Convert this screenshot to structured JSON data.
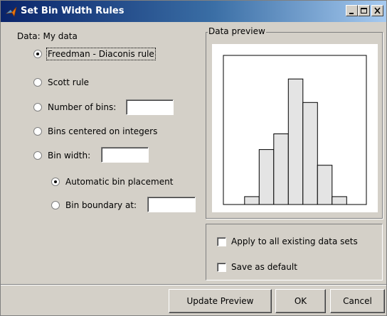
{
  "window": {
    "title": "Set Bin Width Rules"
  },
  "data_label": "Data: My data",
  "rules": [
    {
      "label": "Freedman - Diaconis rule",
      "selected": true
    },
    {
      "label": "Scott rule",
      "selected": false
    },
    {
      "label": "Number of bins:",
      "selected": false,
      "value": ""
    },
    {
      "label": "Bins centered on integers",
      "selected": false
    },
    {
      "label": "Bin width:",
      "selected": false,
      "value": ""
    }
  ],
  "placement": [
    {
      "label": "Automatic bin placement",
      "selected": true
    },
    {
      "label": "Bin boundary at:",
      "selected": false,
      "value": ""
    }
  ],
  "preview": {
    "title": "Data preview",
    "chart_data": {
      "type": "bar",
      "title": "",
      "xlabel": "",
      "ylabel": "",
      "values": [
        1,
        7,
        9,
        16,
        13,
        5,
        1
      ],
      "ylim": [
        0,
        19
      ],
      "grid": false,
      "axes_ticks": false
    }
  },
  "options": {
    "apply_all": {
      "label": "Apply to all existing data sets",
      "checked": false
    },
    "save_default": {
      "label": "Save as default",
      "checked": false
    }
  },
  "buttons": {
    "update": "Update Preview",
    "ok": "OK",
    "cancel": "Cancel"
  }
}
